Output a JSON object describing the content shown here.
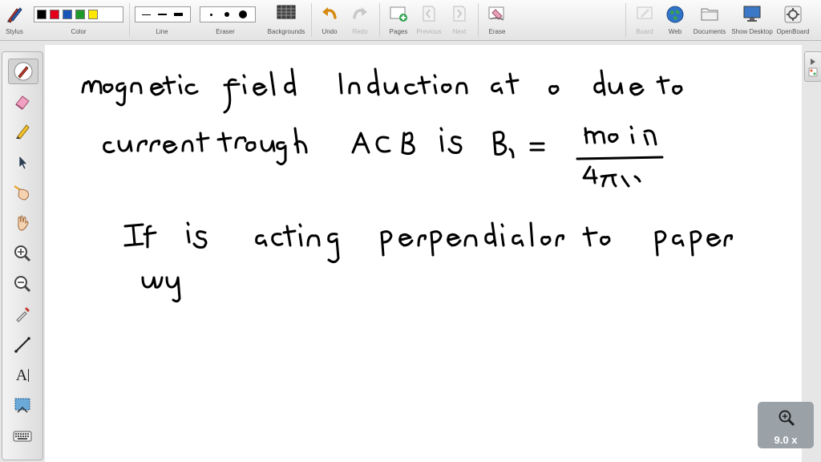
{
  "toolbar": {
    "stylus": "Stylus",
    "color": "Color",
    "line": "Line",
    "eraser": "Eraser",
    "backgrounds": "Backgrounds",
    "undo": "Undo",
    "redo": "Redo",
    "pages": "Pages",
    "previous": "Previous",
    "next": "Next",
    "erase": "Erase",
    "board": "Board",
    "web": "Web",
    "documents": "Documents",
    "show_desktop": "Show Desktop",
    "openboard": "OpenBoard"
  },
  "colors": {
    "swatches": [
      "#000000",
      "#e3001b",
      "#1a56b8",
      "#1f9a2a",
      "#ffe800"
    ],
    "ink": "#000000",
    "board_background": "#ffffff"
  },
  "icons": {
    "palette": [
      "pen-icon",
      "eraser-icon",
      "highlighter-icon",
      "pointer-icon",
      "laser-hand-icon",
      "grab-hand-icon",
      "zoom-in-icon",
      "zoom-out-icon",
      "pipette-icon",
      "line-tool-icon",
      "text-tool-icon",
      "capture-icon",
      "keyboard-icon"
    ]
  },
  "palette": {
    "text_tool": "A"
  },
  "zoom": {
    "label": "9.0 x"
  }
}
